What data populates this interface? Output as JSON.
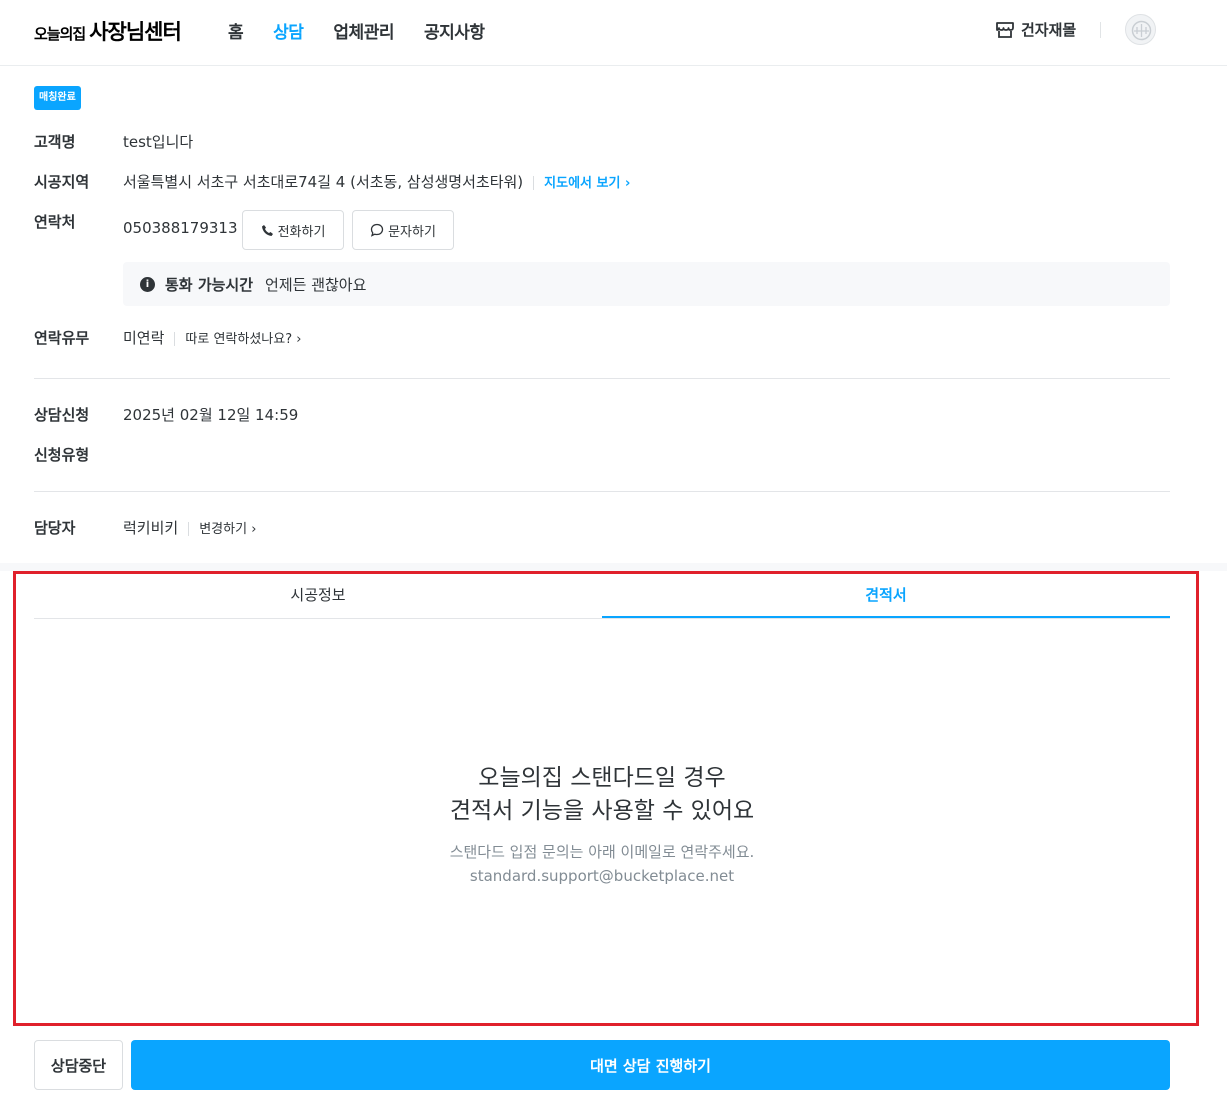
{
  "header": {
    "logo_small": "오늘의집",
    "logo_big": "사장님센터",
    "nav": [
      "홈",
      "상담",
      "업체관리",
      "공지사항"
    ],
    "active_nav": "상담",
    "material_label": "건자재몰"
  },
  "status_badge": "매칭완료",
  "info": {
    "customer_label": "고객명",
    "customer_value": "test입니다",
    "area_label": "시공지역",
    "area_value": "서울특별시 서초구 서초대로74길 4 (서초동, 삼성생명서초타워)",
    "map_link": "지도에서 보기",
    "contact_label": "연락처",
    "contact_value": "050388179313",
    "call_button": "전화하기",
    "sms_button": "문자하기",
    "call_time_title": "통화 가능시간",
    "call_time_value": "언제든 괜찮아요",
    "contacted_label": "연락유무",
    "contacted_value": "미연락",
    "contacted_link": "따로 연락하셨나요?",
    "request_label": "상담신청",
    "request_value": "2025년 02월 12일 14:59",
    "type_label": "신청유형",
    "type_value": "",
    "manager_label": "담당자",
    "manager_value": "럭키비키",
    "manager_link": "변경하기"
  },
  "tabs": [
    "시공정보",
    "견적서"
  ],
  "active_tab": "견적서",
  "empty_state": {
    "title_line1": "오늘의집 스탠다드일 경우",
    "title_line2": "견적서 기능을 사용할 수 있어요",
    "sub_line1": "스탠다드 입점 문의는 아래 이메일로 연락주세요.",
    "sub_line2": "standard.support@bucketplace.net"
  },
  "footer": {
    "stop_button": "상담중단",
    "proceed_button": "대면 상담 진행하기"
  },
  "colors": {
    "accent": "#0aa5ff",
    "highlight": "#e0202b",
    "text": "#2f3438",
    "muted": "#828c94"
  }
}
